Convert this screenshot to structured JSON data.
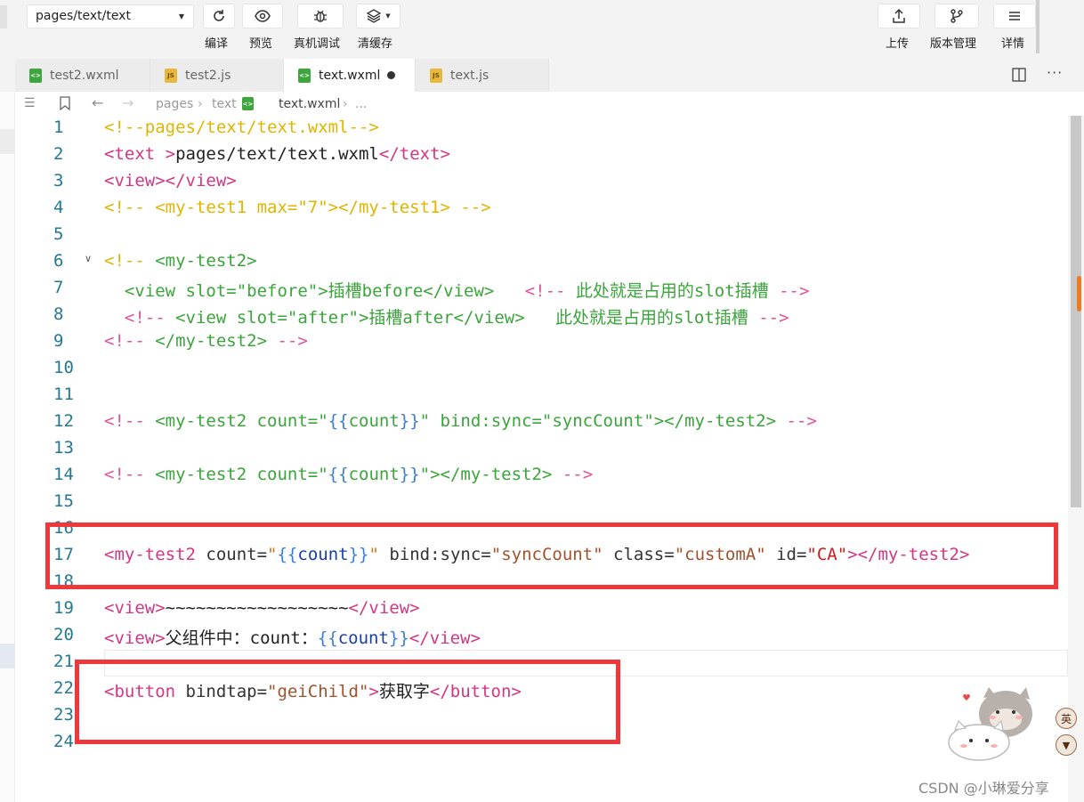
{
  "toolbar": {
    "page_path": "pages/text/text",
    "compile_label": "编译",
    "preview_label": "预览",
    "debug_label": "真机调试",
    "clear_cache_label": "清缓存",
    "upload_label": "上传",
    "version_label": "版本管理",
    "details_label": "详情"
  },
  "tabs": [
    {
      "label": "test2.wxml",
      "icon": "wxml-file-icon",
      "active": false
    },
    {
      "label": "test2.js",
      "icon": "js-file-icon",
      "active": false
    },
    {
      "label": "text.wxml",
      "icon": "wxml-file-icon",
      "active": true,
      "modified": true
    },
    {
      "label": "text.js",
      "icon": "js-file-icon",
      "active": false
    }
  ],
  "breadcrumb": {
    "items": [
      "pages",
      "text",
      "text.wxml",
      "..."
    ]
  },
  "editor": {
    "line_numbers": [
      "1",
      "2",
      "3",
      "4",
      "5",
      "6",
      "7",
      "8",
      "9",
      "10",
      "11",
      "12",
      "13",
      "14",
      "15",
      "16",
      "17",
      "18",
      "19",
      "20",
      "21",
      "22",
      "23",
      "24"
    ],
    "lines": {
      "l1": "<!--pages/text/text.wxml-->",
      "l2_tag_open": "<text ",
      "l2_gt": ">",
      "l2_text": "pages/text/text.wxml",
      "l2_tag_close": "</text>",
      "l3": "<view></view>",
      "l4": "<!-- <my-test1 max=\"7\"></my-test1> -->",
      "l6_a": "<!-- ",
      "l6_b": "<my-test2>",
      "l7_a": "  <view slot=\"before\">插槽before</view>   ",
      "l7_b": "<!-- ",
      "l7_c": "此处就是占用的slot插槽 ",
      "l7_d": "-->",
      "l8_a": "  <!-- ",
      "l8_b": "<view slot=\"after\">插槽after</view>   此处就是占用的slot插槽 ",
      "l8_c": "-->",
      "l9_a": "<!-- ",
      "l9_b": "</my-test2> ",
      "l9_c": "-->",
      "l12_a": "<!-- ",
      "l12_b": "<my-test2 count=\"",
      "l12_c": "{{",
      "l12_d": "count",
      "l12_e": "}}",
      "l12_f": "\" bind:sync=\"syncCount\"></my-test2> ",
      "l12_g": "-->",
      "l14_a": "<!-- ",
      "l14_b": "<my-test2 count=\"",
      "l14_c": "{{",
      "l14_d": "count",
      "l14_e": "}}",
      "l14_f": "\"></my-test2> ",
      "l14_g": "-->",
      "l17_tag": "<my-test2",
      "l17_attr1": " count=",
      "l17_q1": "\"",
      "l17_b1": "{{",
      "l17_var": "count",
      "l17_b2": "}}",
      "l17_q2": "\"",
      "l17_attr2": " bind:sync=",
      "l17_val2": "\"syncCount\"",
      "l17_attr3": " class=",
      "l17_val3": "\"customA\"",
      "l17_attr4": " id=",
      "l17_val4": "\"CA\"",
      "l17_close": "></my-test2>",
      "l19_open": "<view>",
      "l19_text": "~~~~~~~~~~~~~~~~~~",
      "l19_close": "</view>",
      "l20_open": "<view>",
      "l20_text": "父组件中：count：",
      "l20_b1": "{{",
      "l20_var": "count",
      "l20_b2": "}}",
      "l20_close": "</view>",
      "l22_tag": "<button",
      "l22_attr": " bindtap=",
      "l22_val": "\"geiChild\"",
      "l22_gt": ">",
      "l22_text": "获取字",
      "l22_close": "</button>"
    }
  },
  "badges": {
    "lang": "英",
    "shirt": "shirt-icon"
  },
  "watermark": "CSDN @小琳爱分享",
  "colors": {
    "annotation_red": "#f0373a",
    "accent_orange": "#f07a1e"
  }
}
